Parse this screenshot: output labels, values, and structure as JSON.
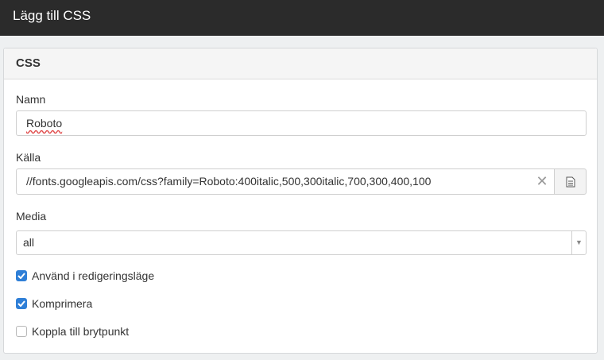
{
  "window": {
    "title": "Lägg till CSS"
  },
  "panel": {
    "title": "CSS"
  },
  "form": {
    "name_label": "Namn",
    "name_value": "Roboto",
    "source_label": "Källa",
    "source_value": "//fonts.googleapis.com/css?family=Roboto:400italic,500,300italic,700,300,400,100",
    "media_label": "Media",
    "media_value": "all",
    "checkboxes": [
      {
        "label": "Använd i redigeringsläge",
        "checked": true
      },
      {
        "label": "Komprimera",
        "checked": true
      },
      {
        "label": "Koppla till brytpunkt",
        "checked": false
      }
    ]
  },
  "icons": {
    "clear": "close-icon",
    "file": "file-icon",
    "dropdown": "chevron-down-icon",
    "check": "checkmark-icon"
  },
  "colors": {
    "titlebar": "#2b2b2b",
    "checkbox_accent": "#2f7fd7"
  }
}
